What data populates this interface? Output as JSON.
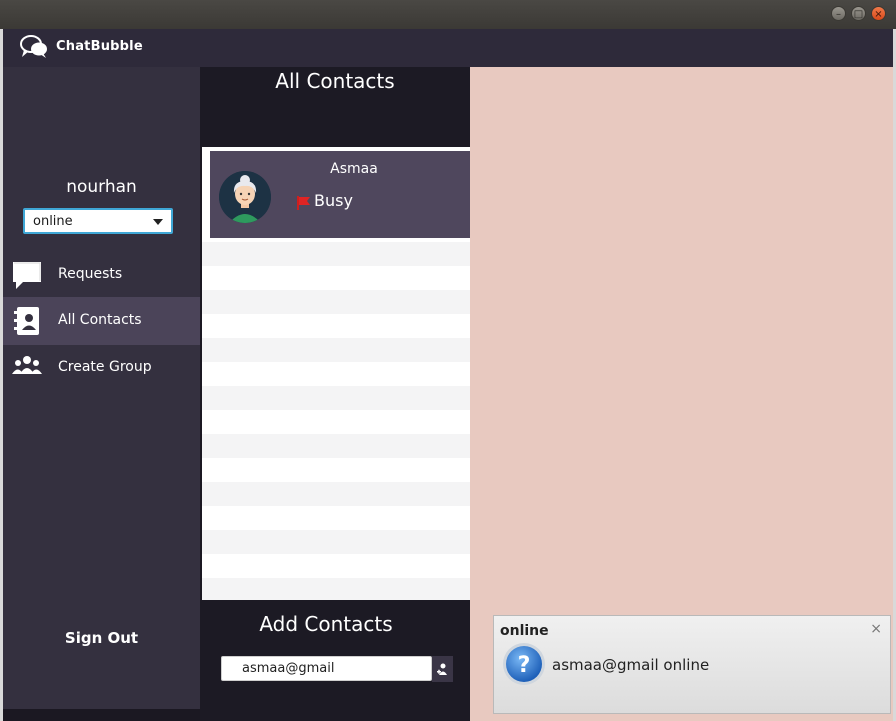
{
  "app": {
    "title": "ChatBubble"
  },
  "window": {
    "minimize_label": "–",
    "maximize_label": "□",
    "close_label": "×"
  },
  "sidebar": {
    "username": "nourhan",
    "status_select": {
      "value": "online"
    },
    "items": [
      {
        "label": "Requests",
        "icon": "chat-bubble-icon"
      },
      {
        "label": "All Contacts",
        "icon": "address-book-icon",
        "active": true
      },
      {
        "label": "Create Group",
        "icon": "group-icon"
      }
    ],
    "sign_out": "Sign Out"
  },
  "contacts": {
    "title": "All Contacts",
    "list": [
      {
        "name": "Asmaa",
        "status": "Busy",
        "avatar": "elderly-woman-avatar",
        "status_icon": "busy-flag-icon"
      }
    ]
  },
  "add_contacts": {
    "title": "Add Contacts",
    "input_value": "asmaa@gmail",
    "button_icon": "add-user-icon"
  },
  "notification": {
    "title": "online",
    "message": "asmaa@gmail online",
    "close_label": "×",
    "icon": "question-icon"
  },
  "colors": {
    "sidebar": "#34303f",
    "header": "#2e2a3a",
    "active_item": "#4b4459",
    "contact_row": "#4f475d",
    "chat_bg": "#e8c9c0",
    "select_border": "#3fa7d6"
  }
}
